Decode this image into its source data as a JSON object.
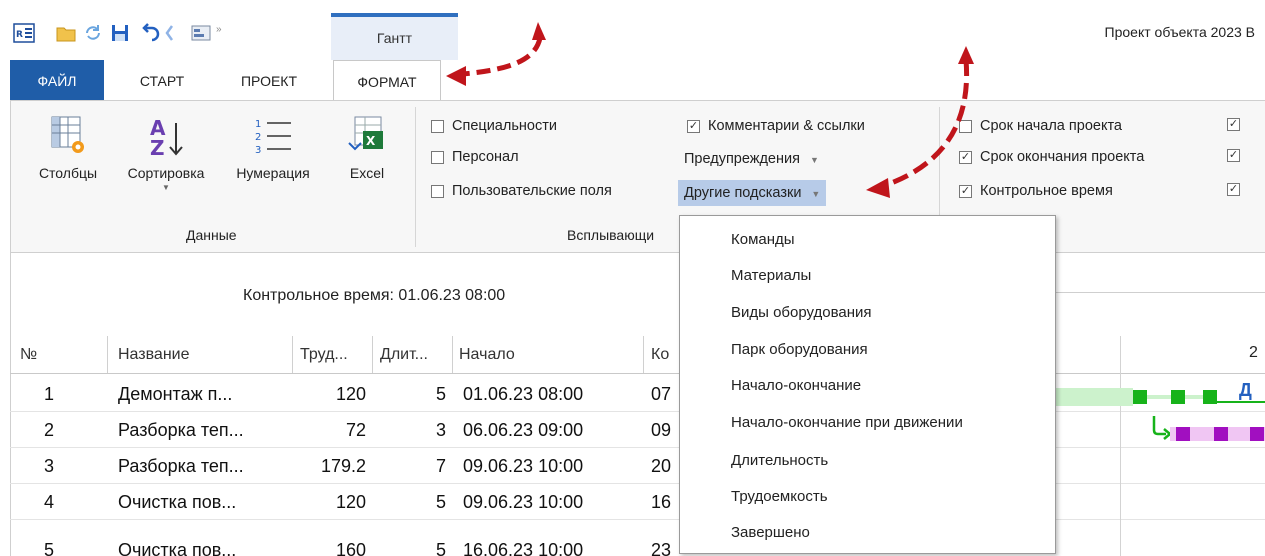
{
  "window": {
    "title": "Проект объекта 2023 В",
    "context_tab": "Гантт",
    "qa_more": "»"
  },
  "tabs": [
    {
      "label": "ФАЙЛ"
    },
    {
      "label": "СТАРТ"
    },
    {
      "label": "ПРОЕКТ"
    },
    {
      "label": "ФОРМАТ"
    }
  ],
  "ribbon": {
    "data_group": {
      "label": "Данные",
      "buttons": [
        {
          "label": "Столбцы",
          "icon": "columns-gear-icon"
        },
        {
          "label": "Сортировка",
          "icon": "sort-az-icon",
          "has_dropdown": true
        },
        {
          "label": "Нумерация",
          "icon": "numbered-list-icon"
        },
        {
          "label": "Excel",
          "icon": "excel-icon"
        }
      ]
    },
    "popups_group": {
      "label": "Всплывающи",
      "checkboxes_col1": [
        {
          "label": "Специальности",
          "checked": false
        },
        {
          "label": "Персонал",
          "checked": false
        },
        {
          "label": "Пользовательские поля",
          "checked": false
        }
      ],
      "checkbox_comments": {
        "label": "Комментарии & ссылки",
        "checked": true
      },
      "warnings_dropdown": "Предупреждения",
      "other_hints_dropdown": "Другие подсказки"
    },
    "lines_group": {
      "checkboxes": [
        {
          "label": "Срок начала проекта",
          "checked": false
        },
        {
          "label": "Срок окончания проекта",
          "checked": true
        },
        {
          "label": "Контрольное время",
          "checked": true
        }
      ]
    }
  },
  "baseline_label": "Контрольное время: 01.06.23 08:00",
  "table": {
    "columns": [
      "№",
      "Название",
      "Труд...",
      "Длит...",
      "Начало",
      "Ко"
    ],
    "rows": [
      {
        "n": "1",
        "name": "Демонтаж п...",
        "work": "120",
        "dur": "5",
        "start": "01.06.23 08:00",
        "end": "07"
      },
      {
        "n": "2",
        "name": "Разборка теп...",
        "work": "72",
        "dur": "3",
        "start": "06.06.23 09:00",
        "end": "09"
      },
      {
        "n": "3",
        "name": "Разборка теп...",
        "work": "179.2",
        "dur": "7",
        "start": "09.06.23 10:00",
        "end": "20"
      },
      {
        "n": "4",
        "name": "Очистка пов...",
        "work": "120",
        "dur": "5",
        "start": "09.06.23 10:00",
        "end": "16"
      },
      {
        "n": "5",
        "name": "Очистка пов...",
        "work": "160",
        "dur": "5",
        "start": "16.06.23 10:00",
        "end": "23"
      }
    ]
  },
  "gantt": {
    "header_label": "2",
    "bar_label": "Д"
  },
  "dropdown_menu": {
    "items": [
      "Команды",
      "Материалы",
      "Виды оборудования",
      "Парк оборудования",
      "Начало-окончание",
      "Начало-окончание при движении",
      "Длительность",
      "Трудоемкость",
      "Завершено"
    ]
  },
  "colors": {
    "file_tab": "#1f5da8",
    "highlight": "#b7cbe8",
    "annotation_arrow": "#c0151b",
    "gantt_green": "#17b31a",
    "gantt_green_light": "#ccf2cc",
    "gantt_purple": "#a10fc0",
    "gantt_purple_light": "#f0c6f3"
  }
}
